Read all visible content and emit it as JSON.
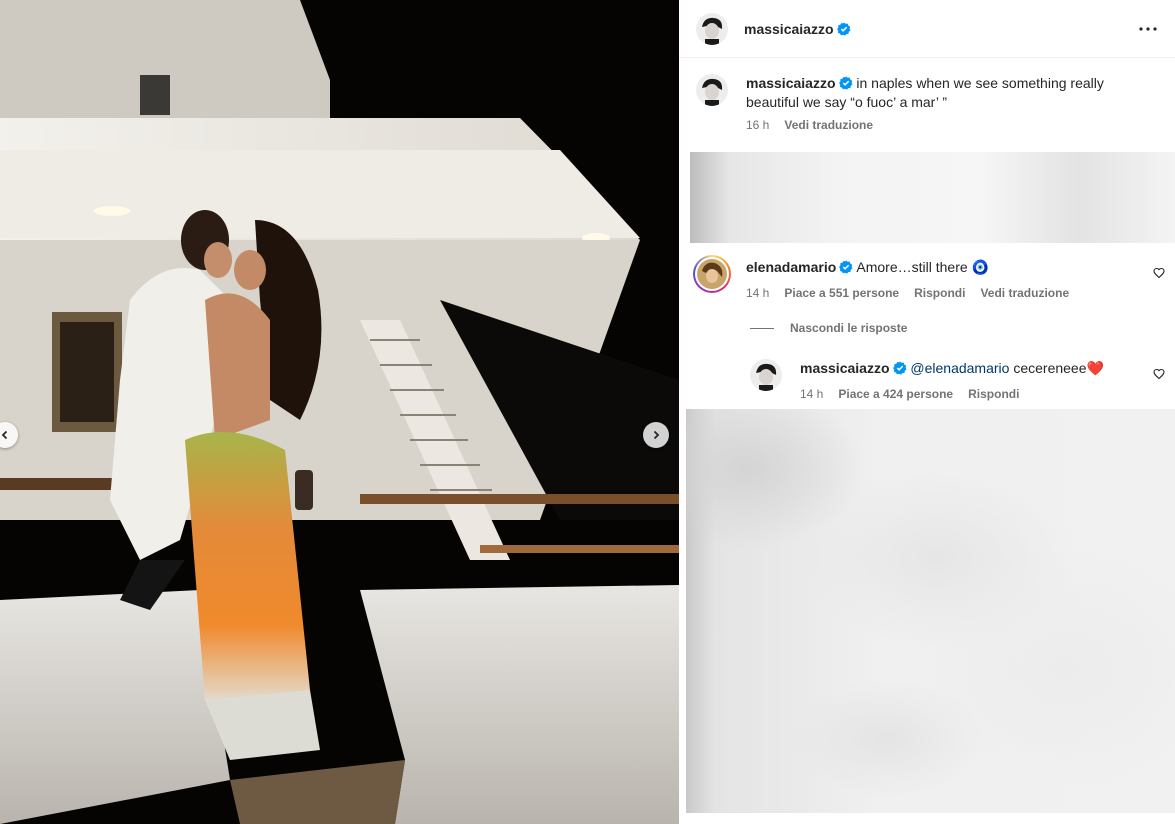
{
  "post": {
    "author": "massicaiazzo",
    "caption": "in naples when we see something really beautiful we say “o fuoc’ a mar’ ”",
    "caption_time": "16 h",
    "caption_translate": "Vedi traduzione"
  },
  "comments": [
    {
      "author": "elenadamario",
      "text": "Amore…still there",
      "emoji": "🧿",
      "time": "14 h",
      "likes": "Piace a 551 persone",
      "reply": "Rispondi",
      "translate": "Vedi traduzione"
    }
  ],
  "hide_replies": "Nascondi le risposte",
  "reply": {
    "author": "massicaiazzo",
    "mention": "@elenadamario",
    "text": "cecereneee❤️",
    "time": "14 h",
    "likes": "Piace a 424 persone",
    "reply": "Rispondi"
  },
  "icons": {
    "verified": "verified-badge-icon",
    "more": "more-options-icon",
    "like": "heart-icon",
    "prev": "chevron-left-icon",
    "next": "chevron-right-icon"
  },
  "colors": {
    "verified": "#0095f6",
    "muted_text": "#737373",
    "mention": "#00376b",
    "photo_bg": "#050403"
  }
}
